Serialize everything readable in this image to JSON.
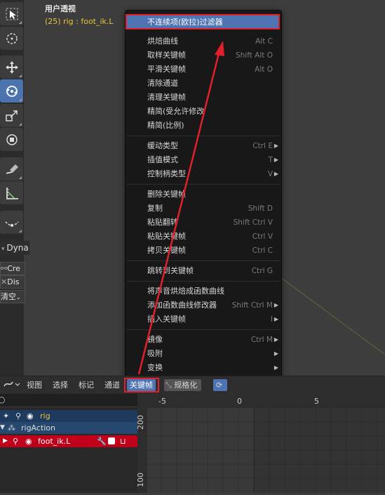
{
  "viewport": {
    "title": "用户透视",
    "subtitle": "(25) rig : foot_ik.L"
  },
  "toolbar": [
    {
      "name": "select-box-icon"
    },
    {
      "name": "cursor-icon"
    },
    {
      "name": "move-icon"
    },
    {
      "name": "rotate-icon"
    },
    {
      "name": "scale-icon"
    },
    {
      "name": "transform-icon"
    },
    {
      "name": "annotate-icon"
    },
    {
      "name": "measure-icon"
    },
    {
      "name": "pose-relax-icon"
    }
  ],
  "side_panel": {
    "tab": "Dyna",
    "create": "Cre",
    "dissolve": "Dis",
    "clear": "清空"
  },
  "menu": {
    "highlighted": "不连续项(欧拉)过滤器",
    "groups": [
      [
        {
          "label": "烘焙曲线",
          "shortcut": "Alt C"
        },
        {
          "label": "取样关键帧",
          "shortcut": "Shift Alt O"
        },
        {
          "label": "平滑关键帧",
          "shortcut": "Alt O"
        },
        {
          "label": "清除通道",
          "shortcut": ""
        },
        {
          "label": "清理关键帧",
          "shortcut": ""
        },
        {
          "label": "精简(受允许修改",
          "shortcut": ""
        },
        {
          "label": "精简(比例)",
          "shortcut": ""
        }
      ],
      [
        {
          "label": "缓动类型",
          "shortcut": "Ctrl E",
          "submenu": true
        },
        {
          "label": "插值模式",
          "shortcut": "T",
          "submenu": true
        },
        {
          "label": "控制柄类型",
          "shortcut": "V",
          "submenu": true
        }
      ],
      [
        {
          "label": "删除关键帧",
          "shortcut": ""
        },
        {
          "label": "复制",
          "shortcut": "Shift D"
        },
        {
          "label": "粘贴翻转",
          "shortcut": "Shift Ctrl V"
        },
        {
          "label": "粘贴关键帧",
          "shortcut": "Ctrl V"
        },
        {
          "label": "拷贝关键帧",
          "shortcut": "Ctrl C"
        }
      ],
      [
        {
          "label": "跳转到关键帧",
          "shortcut": "Ctrl G"
        }
      ],
      [
        {
          "label": "将声音烘焙成函数曲线",
          "shortcut": ""
        },
        {
          "label": "添加函数曲线修改器",
          "shortcut": "Shift Ctrl M",
          "submenu": true
        },
        {
          "label": "插入关键帧",
          "shortcut": "I",
          "submenu": true
        }
      ],
      [
        {
          "label": "镜像",
          "shortcut": "Ctrl M",
          "submenu": true
        },
        {
          "label": "吸附",
          "shortcut": "",
          "submenu": true
        },
        {
          "label": "变换",
          "shortcut": "",
          "submenu": true
        }
      ]
    ]
  },
  "header": {
    "menus": [
      "视图",
      "选择",
      "标记",
      "通道",
      "关键帧"
    ],
    "normalize": "规格化"
  },
  "channels": {
    "object": "rig",
    "action": "rigAction",
    "bone": "foot_ik.L"
  },
  "graph": {
    "frame_ticks": [
      "-5",
      "0",
      "5"
    ],
    "value_ticks": [
      "200",
      "100"
    ]
  },
  "colors": {
    "accent": "#4f74b3",
    "annotation": "#e0202a",
    "bone_row": "#c0001a"
  }
}
